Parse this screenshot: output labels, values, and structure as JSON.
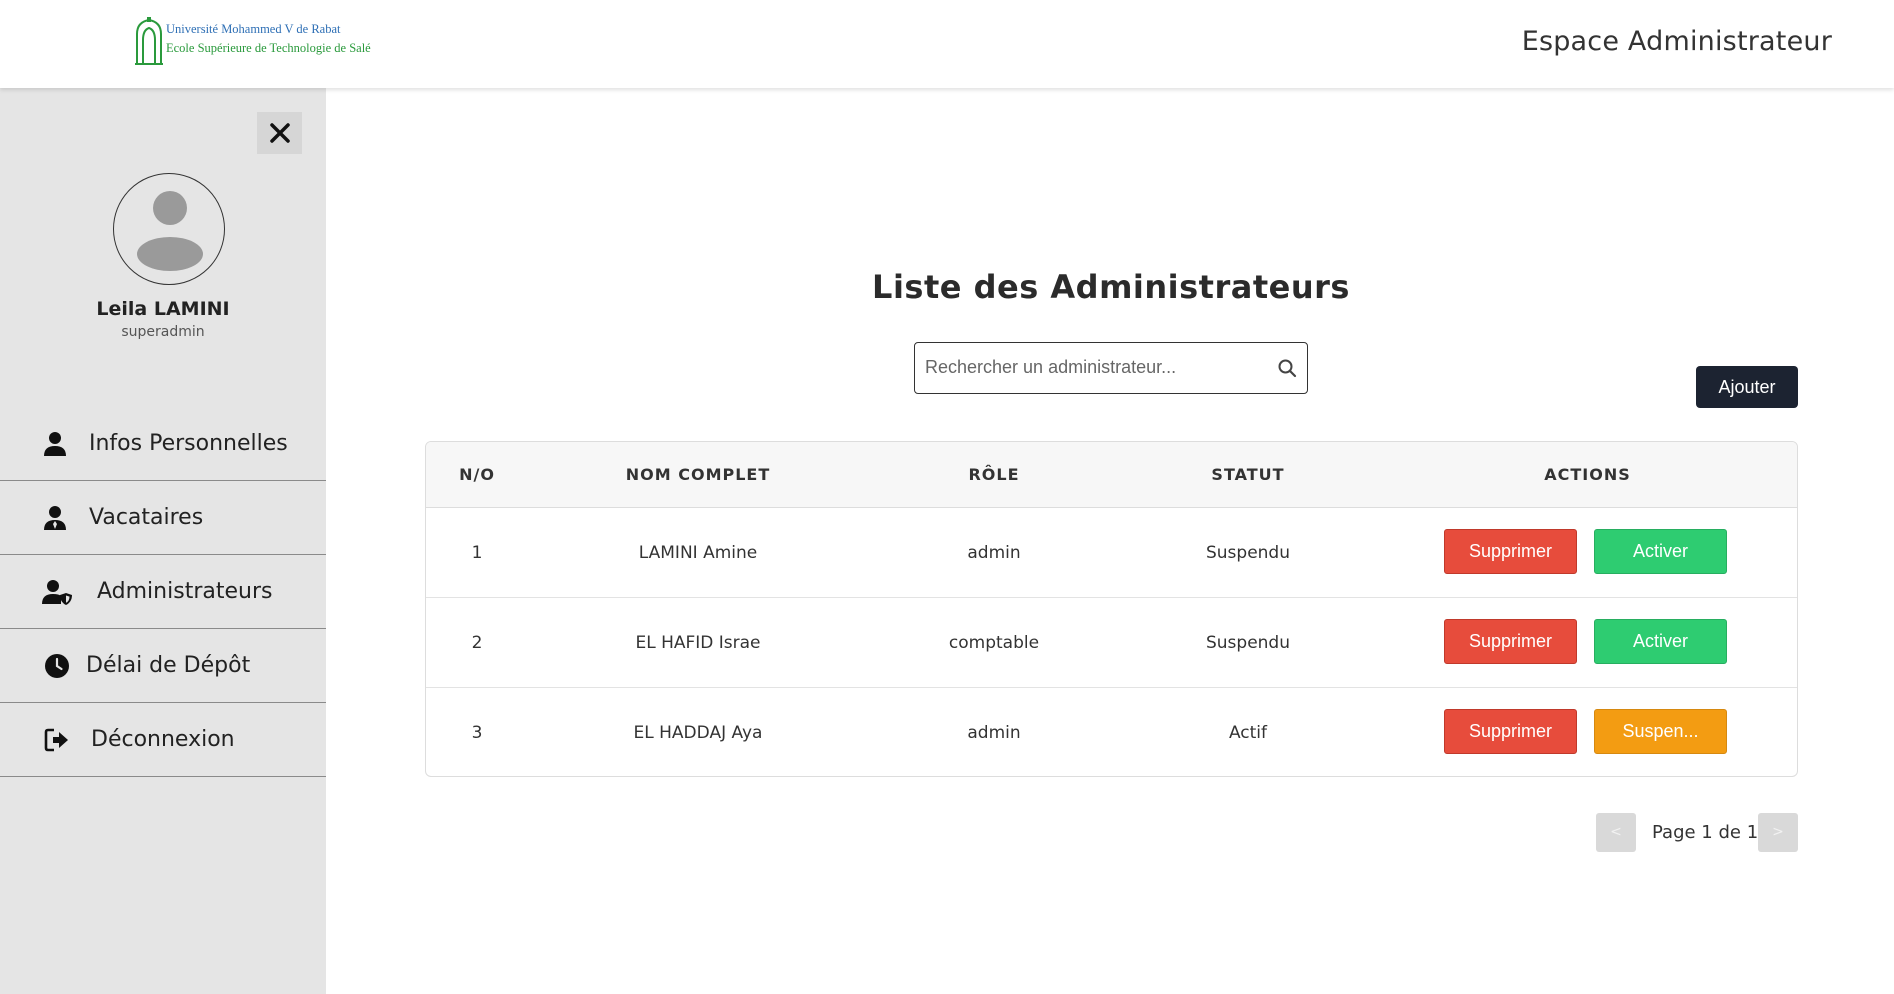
{
  "header": {
    "logo_line1": "Université Mohammed V de Rabat",
    "logo_line2": "Ecole Supérieure de Technologie de Salé",
    "title": "Espace Administrateur"
  },
  "sidebar": {
    "close_icon": "close-icon",
    "user": {
      "name": "Leila LAMINI",
      "role": "superadmin",
      "avatar_icon": "user-avatar-icon"
    },
    "items": [
      {
        "label": "Infos Personnelles",
        "icon": "user-icon"
      },
      {
        "label": "Vacataires",
        "icon": "user-tie-icon"
      },
      {
        "label": "Administrateurs",
        "icon": "user-shield-icon"
      },
      {
        "label": "Délai de Dépôt",
        "icon": "clock-icon"
      },
      {
        "label": "Déconnexion",
        "icon": "sign-out-icon"
      }
    ]
  },
  "main": {
    "title": "Liste des Administrateurs",
    "search": {
      "placeholder": "Rechercher un administrateur...",
      "value": "",
      "icon": "search-icon"
    },
    "add_label": "Ajouter",
    "table": {
      "columns": [
        "N/O",
        "NOM COMPLET",
        "RÔLE",
        "STATUT",
        "ACTIONS"
      ],
      "rows": [
        {
          "no": "1",
          "name": "LAMINI Amine",
          "role": "admin",
          "status": "Suspendu",
          "delete_label": "Supprimer",
          "toggle_label": "Activer"
        },
        {
          "no": "2",
          "name": "EL HAFID Israe",
          "role": "comptable",
          "status": "Suspendu",
          "delete_label": "Supprimer",
          "toggle_label": "Activer"
        },
        {
          "no": "3",
          "name": "EL HADDAJ Aya",
          "role": "admin",
          "status": "Actif",
          "delete_label": "Supprimer",
          "toggle_label": "Suspen..."
        }
      ]
    },
    "pagination": {
      "prev": "<",
      "next": ">",
      "label": "Page 1 de 1"
    }
  },
  "colors": {
    "delete": "#e74c3c",
    "activate": "#2ecc71",
    "suspend": "#f39c12",
    "primary_dark": "#1c2331",
    "sidebar_bg": "#e5e5e5"
  }
}
